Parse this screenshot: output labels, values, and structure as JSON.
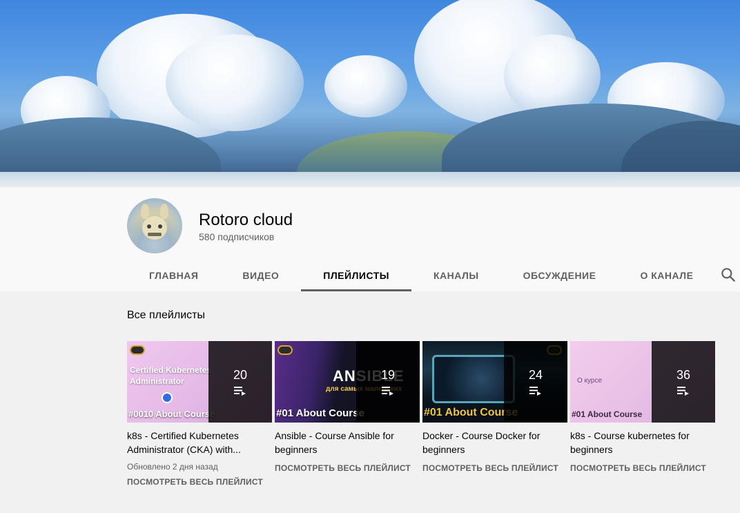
{
  "channel": {
    "name": "Rotoro cloud",
    "subscribers": "580 подписчиков"
  },
  "tabs": [
    {
      "label": "ГЛАВНАЯ",
      "active": false
    },
    {
      "label": "ВИДЕО",
      "active": false
    },
    {
      "label": "ПЛЕЙЛИСТЫ",
      "active": true
    },
    {
      "label": "КАНАЛЫ",
      "active": false
    },
    {
      "label": "ОБСУЖДЕНИЕ",
      "active": false
    },
    {
      "label": "О КАНАЛЕ",
      "active": false
    }
  ],
  "search": {
    "icon": "search-icon"
  },
  "section": {
    "title": "Все плейлисты"
  },
  "playlists": [
    {
      "thumb_text": "Certified Kubernetes Administrator",
      "thumb_label": "#0010 About Course",
      "count": "20",
      "title": "k8s - Certified Kubernetes Administrator (CKA) with...",
      "updated": "Обновлено 2 дня назад",
      "link": "ПОСМОТРЕТЬ ВЕСЬ ПЛЕЙЛИСТ"
    },
    {
      "thumb_text": "ANSIBLE",
      "thumb_sub": "для самых маленьких",
      "thumb_label": "#01 About Course",
      "count": "19",
      "title": "Ansible - Course Ansible for beginners",
      "link": "ПОСМОТРЕТЬ ВЕСЬ ПЛЕЙЛИСТ"
    },
    {
      "thumb_label": "#01 About Course",
      "count": "24",
      "title": "Docker - Course Docker for beginners",
      "link": "ПОСМОТРЕТЬ ВЕСЬ ПЛЕЙЛИСТ"
    },
    {
      "thumb_text": "О курсе",
      "thumb_label": "#01 About Course",
      "count": "36",
      "title": "k8s - Course kubernetes for beginners",
      "link": "ПОСМОТРЕТЬ ВЕСЬ ПЛЕЙЛИСТ"
    }
  ],
  "colors": {
    "accent_underline": "#606060",
    "text_primary": "#030303",
    "text_secondary": "#606060",
    "badge_gold": "#d4a62a"
  }
}
